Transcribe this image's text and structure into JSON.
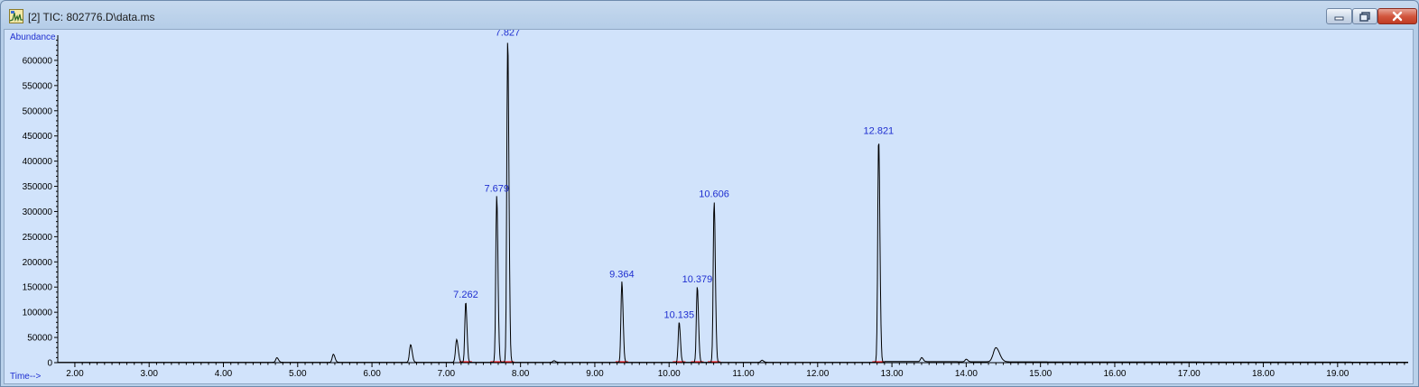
{
  "window": {
    "title": "[2] TIC: 802776.D\\data.ms",
    "icon": "chromatogram-app-icon",
    "controls": [
      "minimize",
      "maximize",
      "close"
    ],
    "colors": {
      "plot_background": "#d1e3fb",
      "trace": "#000000",
      "label_text": "#1f2fd0",
      "baseline_marks": "#ff0000"
    }
  },
  "chart_data": {
    "type": "line",
    "title": "",
    "ylabel": "Abundance",
    "xlabel": "Time-->",
    "xlim": [
      1.77,
      19.95
    ],
    "ylim": [
      0,
      650000
    ],
    "y_ticks": [
      0,
      50000,
      100000,
      150000,
      200000,
      250000,
      300000,
      350000,
      400000,
      450000,
      500000,
      550000,
      600000
    ],
    "x_ticks": [
      "2.00",
      "3.00",
      "4.00",
      "5.00",
      "6.00",
      "7.00",
      "8.00",
      "9.00",
      "10.00",
      "11.00",
      "12.00",
      "13.00",
      "14.00",
      "15.00",
      "16.00",
      "17.00",
      "18.00",
      "19.00"
    ],
    "grid": false,
    "labeled_peaks": [
      {
        "rt": 7.262,
        "label": "7.262",
        "height": 120000
      },
      {
        "rt": 7.679,
        "label": "7.679",
        "height": 330000
      },
      {
        "rt": 7.827,
        "label": "7.827",
        "height": 640000
      },
      {
        "rt": 9.364,
        "label": "9.364",
        "height": 160000
      },
      {
        "rt": 10.135,
        "label": "10.135",
        "height": 80000
      },
      {
        "rt": 10.379,
        "label": "10.379",
        "height": 150000
      },
      {
        "rt": 10.606,
        "label": "10.606",
        "height": 320000
      },
      {
        "rt": 12.821,
        "label": "12.821",
        "height": 445000
      }
    ],
    "minor_peaks": [
      {
        "rt": 4.72,
        "height": 9000
      },
      {
        "rt": 5.48,
        "height": 16000
      },
      {
        "rt": 6.52,
        "height": 35000
      },
      {
        "rt": 7.14,
        "height": 45000
      },
      {
        "rt": 8.45,
        "height": 3000
      },
      {
        "rt": 11.25,
        "height": 4000
      },
      {
        "rt": 13.4,
        "height": 8000
      },
      {
        "rt": 14.0,
        "height": 5000
      },
      {
        "rt": 14.4,
        "height": 28000
      }
    ]
  }
}
